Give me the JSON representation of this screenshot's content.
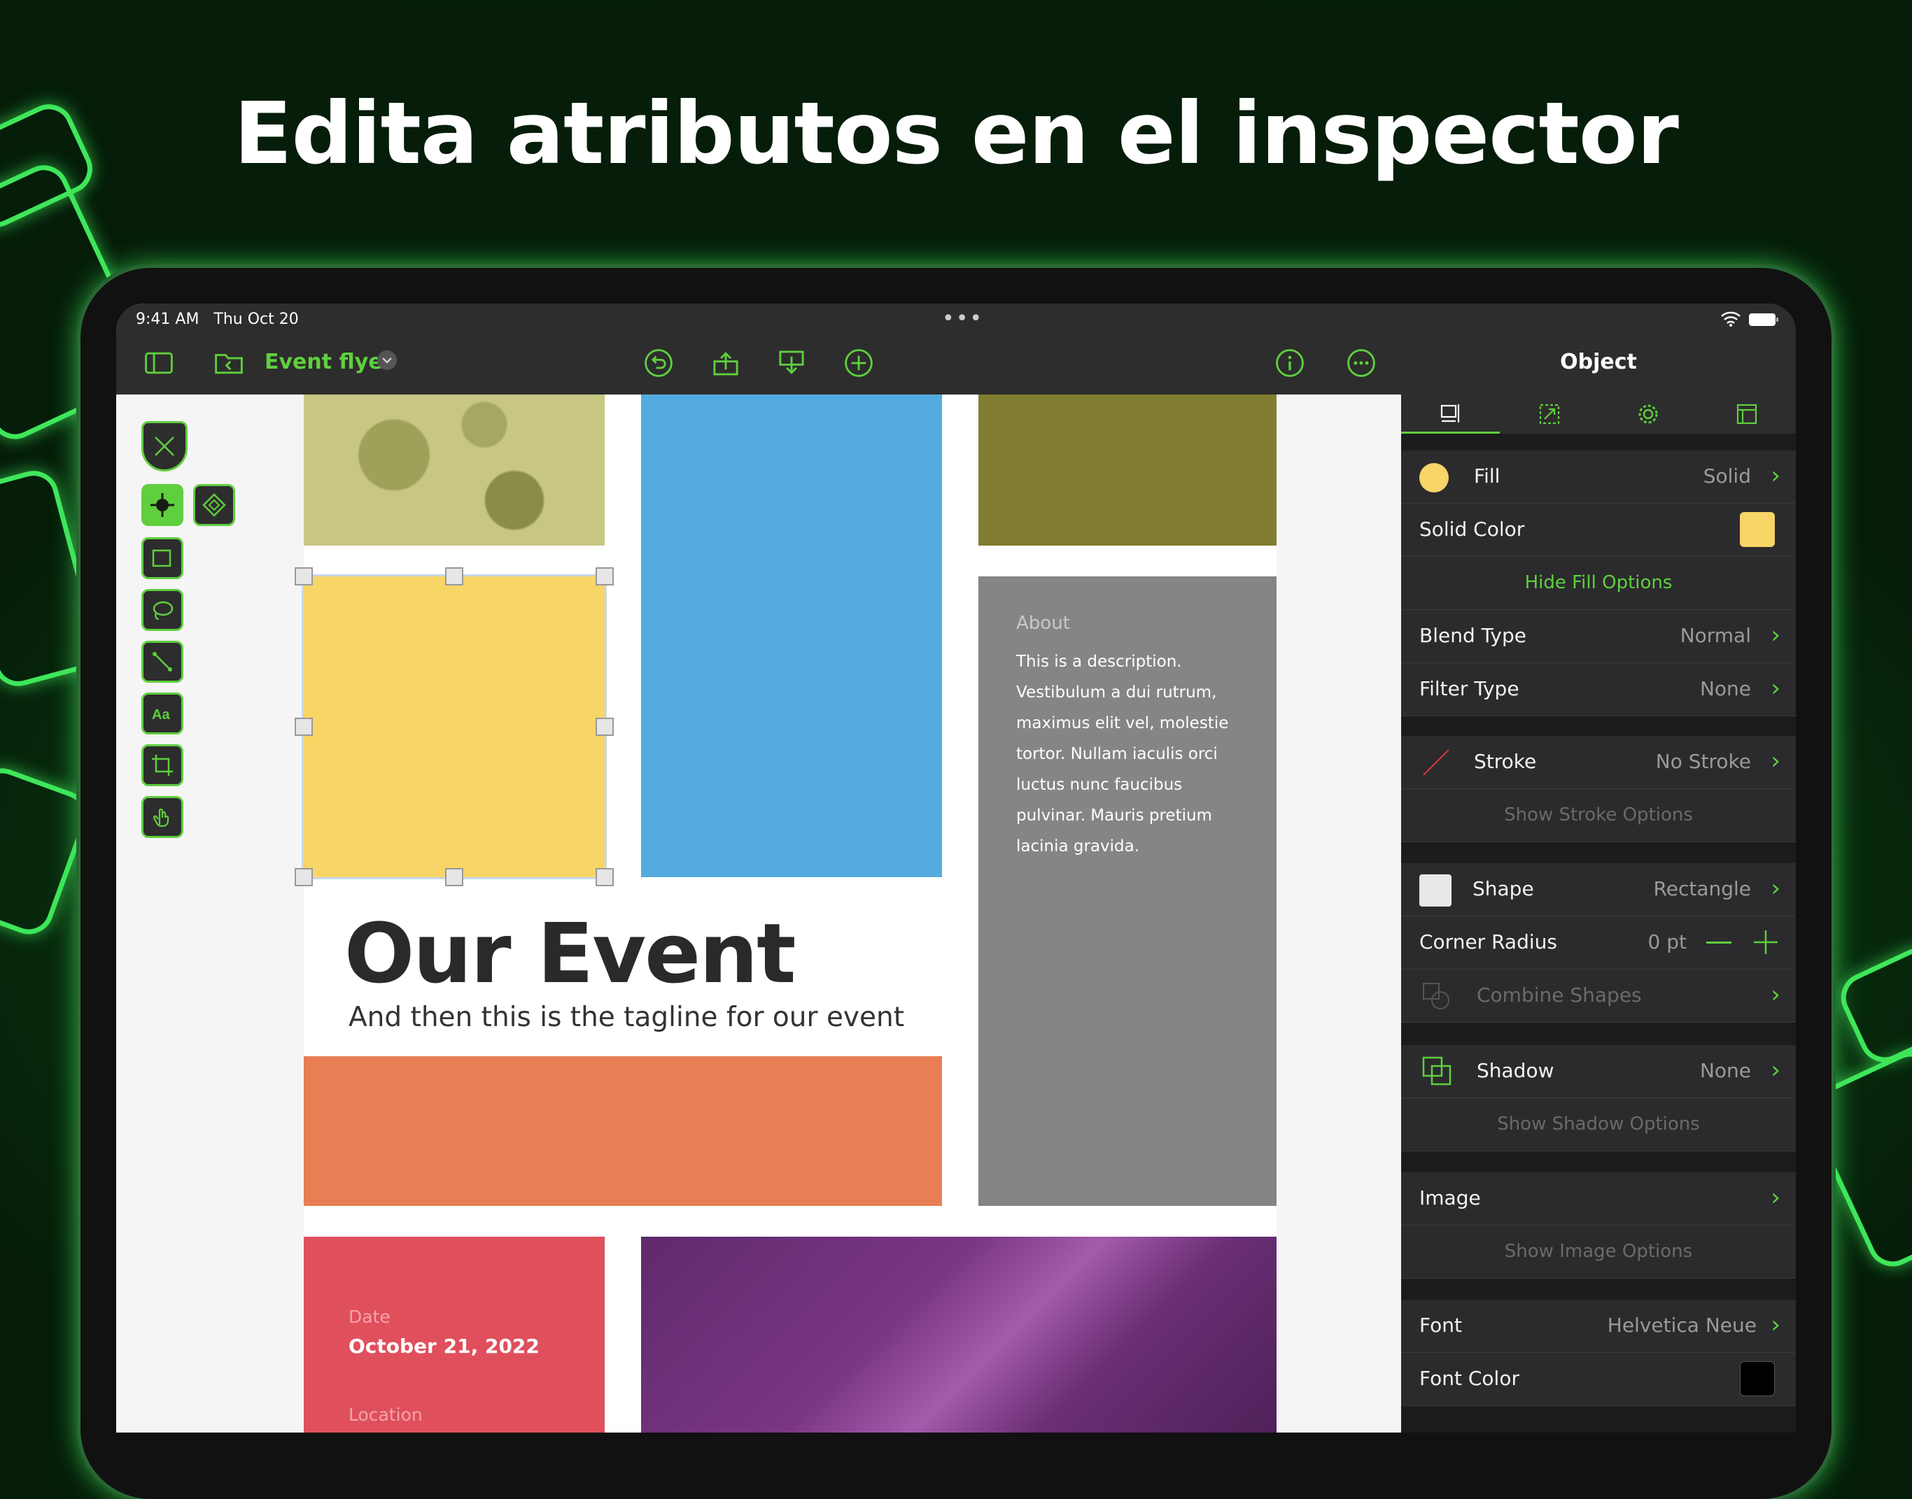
{
  "headline": "Edita atributos en el inspector",
  "status": {
    "time": "9:41 AM",
    "date": "Thu Oct 20",
    "more": "•••"
  },
  "toolbar": {
    "document_title": "Event flyer"
  },
  "document": {
    "about_heading": "About",
    "about_body": [
      "This is a description.",
      "Vestibulum a dui rutrum,",
      "maximus elit vel, molestie",
      "tortor. Nullam iaculis orci",
      "luctus nunc faucibus",
      "pulvinar. Mauris pretium",
      "lacinia gravida."
    ],
    "title": "Our Event",
    "tagline": "And then this is the tagline for our event",
    "date_label": "Date",
    "date_value": "October 21, 2022",
    "location_label": "Location"
  },
  "inspector": {
    "title": "Object",
    "fill": {
      "label": "Fill",
      "value": "Solid"
    },
    "solid_color": {
      "label": "Solid Color",
      "color": "#f7d567"
    },
    "hide_fill": "Hide Fill Options",
    "blend": {
      "label": "Blend Type",
      "value": "Normal"
    },
    "filter": {
      "label": "Filter Type",
      "value": "None"
    },
    "stroke": {
      "label": "Stroke",
      "value": "No Stroke"
    },
    "show_stroke": "Show Stroke Options",
    "shape": {
      "label": "Shape",
      "value": "Rectangle"
    },
    "corner_radius": {
      "label": "Corner Radius",
      "value": "0 pt"
    },
    "combine": {
      "label": "Combine Shapes"
    },
    "shadow": {
      "label": "Shadow",
      "value": "None"
    },
    "show_shadow": "Show Shadow Options",
    "image": {
      "label": "Image"
    },
    "show_image": "Show Image Options",
    "font": {
      "label": "Font",
      "value": "Helvetica Neue"
    },
    "font_color": {
      "label": "Font Color",
      "color": "#000000"
    }
  },
  "colors": {
    "accent": "#5fcf3e",
    "yellow": "#f7d567",
    "blue": "#54abe0",
    "olive": "#817d30",
    "gray": "#858585",
    "orange": "#e87e54",
    "red": "#e04f5c",
    "purple": "#6e2f77"
  }
}
